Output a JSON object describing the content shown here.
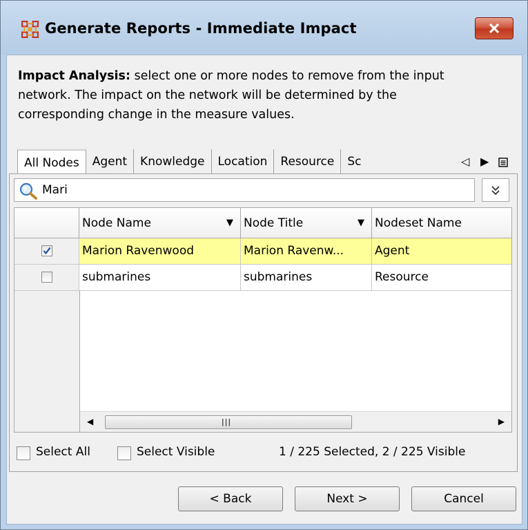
{
  "window": {
    "title": "Generate Reports - Immediate Impact",
    "close_label": "close"
  },
  "description": {
    "bold_lead": "Impact Analysis:",
    "line1": " select one or more nodes to remove from the input",
    "line2": "network. The impact on the network will be determined by the",
    "line3": "corresponding change in the measure values."
  },
  "tabs": [
    {
      "label": "All Nodes",
      "active": true
    },
    {
      "label": "Agent"
    },
    {
      "label": "Knowledge"
    },
    {
      "label": "Location"
    },
    {
      "label": "Resource"
    },
    {
      "label": "Sc"
    }
  ],
  "search": {
    "value": "Mari"
  },
  "table": {
    "columns": [
      "Node Name",
      "Node Title",
      "Nodeset Name"
    ],
    "rows": [
      {
        "checked": true,
        "node_name": "Marion Ravenwood",
        "node_title": "Marion Ravenw...",
        "nodeset": "Agent"
      },
      {
        "checked": false,
        "node_name": "submarines",
        "node_title": "submarines",
        "nodeset": "Resource"
      }
    ]
  },
  "selection": {
    "select_all": "Select All",
    "select_visible": "Select Visible",
    "status": "1 / 225 Selected, 2 / 225 Visible"
  },
  "buttons": {
    "back": "< Back",
    "next": "Next >",
    "cancel": "Cancel"
  },
  "colors": {
    "selected_row": "#ffff99",
    "title_bar": "#b9d1ea",
    "close_button": "#c8452d"
  }
}
